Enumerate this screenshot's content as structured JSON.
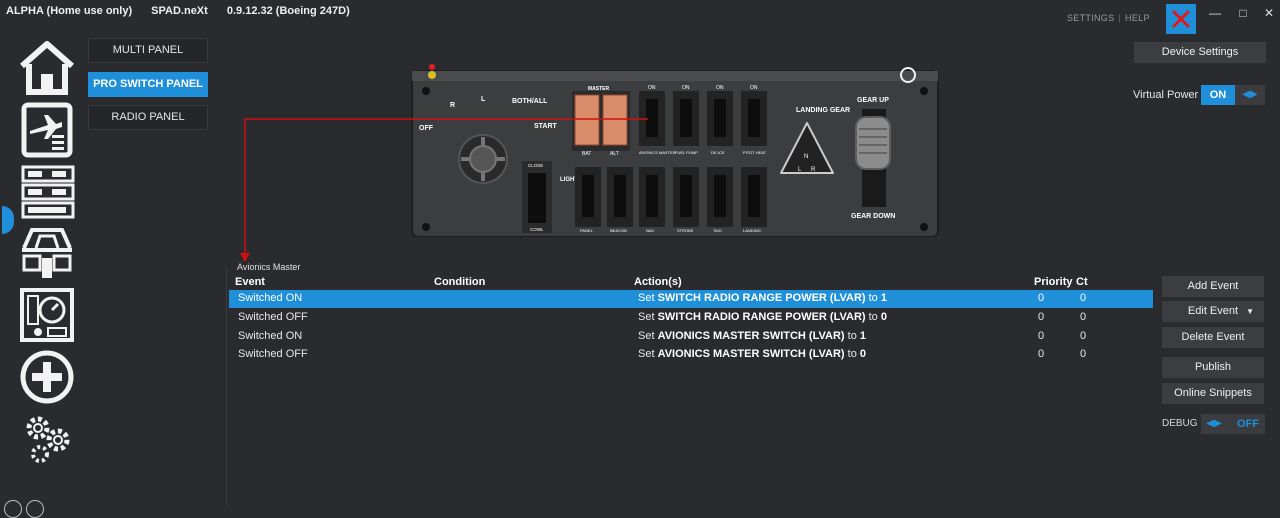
{
  "titlebar": {
    "edition": "ALPHA (Home use only)",
    "app_name": "SPAD.neXt",
    "version": "0.9.12.32 (Boeing 247D)",
    "settings_link": "SETTINGS",
    "help_link": "HELP"
  },
  "rail": {
    "icons": [
      "home-icon",
      "flight-plan-icon",
      "radio-stack-icon",
      "cockpit-icon",
      "gauges-icon",
      "add-icon",
      "settings-gears-icon"
    ],
    "active_index": 2
  },
  "panel_tabs": [
    {
      "label": "MULTI PANEL"
    },
    {
      "label": "PRO SWITCH PANEL"
    },
    {
      "label": "RADIO PANEL"
    }
  ],
  "switch_panel": {
    "magneto": [
      "OFF",
      "R",
      "L",
      "BOTH/ALL",
      "START"
    ],
    "master_label": "MASTER",
    "master_sub": [
      "BAT",
      "ALT"
    ],
    "top_switches": [
      "AVIONICS MASTER",
      "FUEL PUMP",
      "DE-ICE",
      "PITOT HEAT"
    ],
    "lights_label": "LIGHTS",
    "cowl_labels": [
      "CLOSE",
      "COWL"
    ],
    "bottom_switches": [
      "PANEL",
      "BEACON",
      "NAV.",
      "STROBE",
      "TAXI",
      "LANDING"
    ],
    "on_label": "ON",
    "landing_gear": "LANDING GEAR",
    "gear_letters": [
      "N",
      "L",
      "R"
    ],
    "gear_up": "GEAR UP",
    "gear_down": "GEAR DOWN"
  },
  "device": {
    "settings_button": "Device Settings",
    "virtual_power_label": "Virtual Power",
    "virtual_power_state": "ON"
  },
  "events": {
    "group_label": "Avionics Master",
    "columns": [
      "Event",
      "Condition",
      "Action(s)",
      "Priority",
      "Ct"
    ],
    "rows": [
      {
        "event": "Switched ON",
        "condition": "",
        "prefix": "Set",
        "target": "SWITCH RADIO RANGE POWER (LVAR)",
        "mid": "to",
        "value": "1",
        "priority": "0",
        "ct": "0"
      },
      {
        "event": "Switched OFF",
        "condition": "",
        "prefix": "Set",
        "target": "SWITCH RADIO RANGE POWER (LVAR)",
        "mid": "to",
        "value": "0",
        "priority": "0",
        "ct": "0"
      },
      {
        "event": "Switched ON",
        "condition": "",
        "prefix": "Set",
        "target": "AVIONICS MASTER SWITCH (LVAR)",
        "mid": "to",
        "value": "1",
        "priority": "0",
        "ct": "0"
      },
      {
        "event": "Switched OFF",
        "condition": "",
        "prefix": "Set",
        "target": "AVIONICS MASTER SWITCH (LVAR)",
        "mid": "to",
        "value": "0",
        "priority": "0",
        "ct": "0"
      }
    ],
    "selected_row": 0
  },
  "actions": {
    "add_event": "Add Event",
    "edit_event": "Edit Event",
    "delete_event": "Delete Event",
    "publish": "Publish",
    "online_snippets": "Online Snippets",
    "debug_label": "DEBUG",
    "debug_state": "OFF"
  },
  "colors": {
    "accent": "#1e8fd8",
    "background": "#2a2b2e",
    "button": "#3b3d41",
    "master_switch": "#d98c6a",
    "callout_line": "#d01010"
  }
}
